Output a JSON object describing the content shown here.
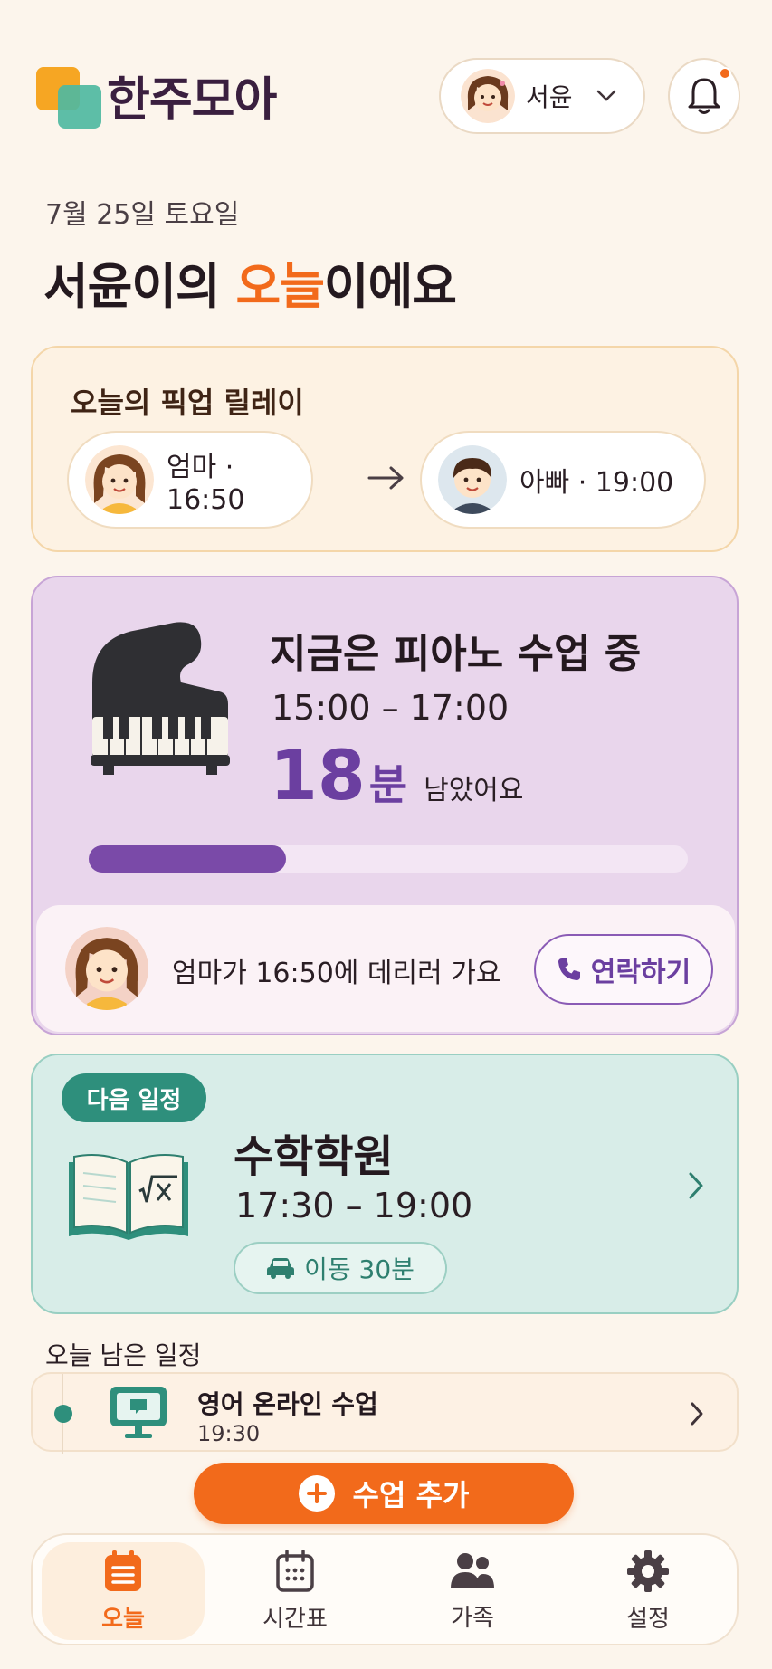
{
  "app": {
    "name": "한주모아"
  },
  "profile": {
    "name": "서윤"
  },
  "header": {
    "date": "7월 25일 토요일",
    "headline_pre": "서윤이의 ",
    "headline_highlight": "오늘",
    "headline_post": "이에요"
  },
  "relay": {
    "title": "오늘의 픽업 릴레이",
    "items": [
      {
        "label": "엄마 · 16:50"
      },
      {
        "label": "아빠 · 19:00"
      }
    ]
  },
  "now": {
    "title": "지금은 피아노 수업 중",
    "time": "15:00 – 17:00",
    "remaining_value": "18",
    "remaining_unit": "분",
    "remaining_text": "남았어요",
    "progress": 0.33,
    "pickup_text": "엄마가 16:50에 데리러 가요",
    "contact_label": "연락하기"
  },
  "next": {
    "badge": "다음 일정",
    "title": "수학학원",
    "time": "17:30 – 19:00",
    "travel": "이동 30분"
  },
  "remaining": {
    "title": "오늘 남은 일정",
    "items": [
      {
        "title": "영어 온라인 수업",
        "time": "19:30"
      }
    ]
  },
  "add_button": {
    "label": "수업 추가"
  },
  "nav": {
    "items": [
      {
        "label": "오늘",
        "icon": "list-icon",
        "active": true
      },
      {
        "label": "시간표",
        "icon": "calendar-icon",
        "active": false
      },
      {
        "label": "가족",
        "icon": "family-icon",
        "active": false
      },
      {
        "label": "설정",
        "icon": "gear-icon",
        "active": false
      }
    ]
  },
  "colors": {
    "accent": "#F26A1B",
    "purple": "#6B3FA0",
    "teal": "#2E8F7C",
    "background": "#FCF5EC"
  }
}
